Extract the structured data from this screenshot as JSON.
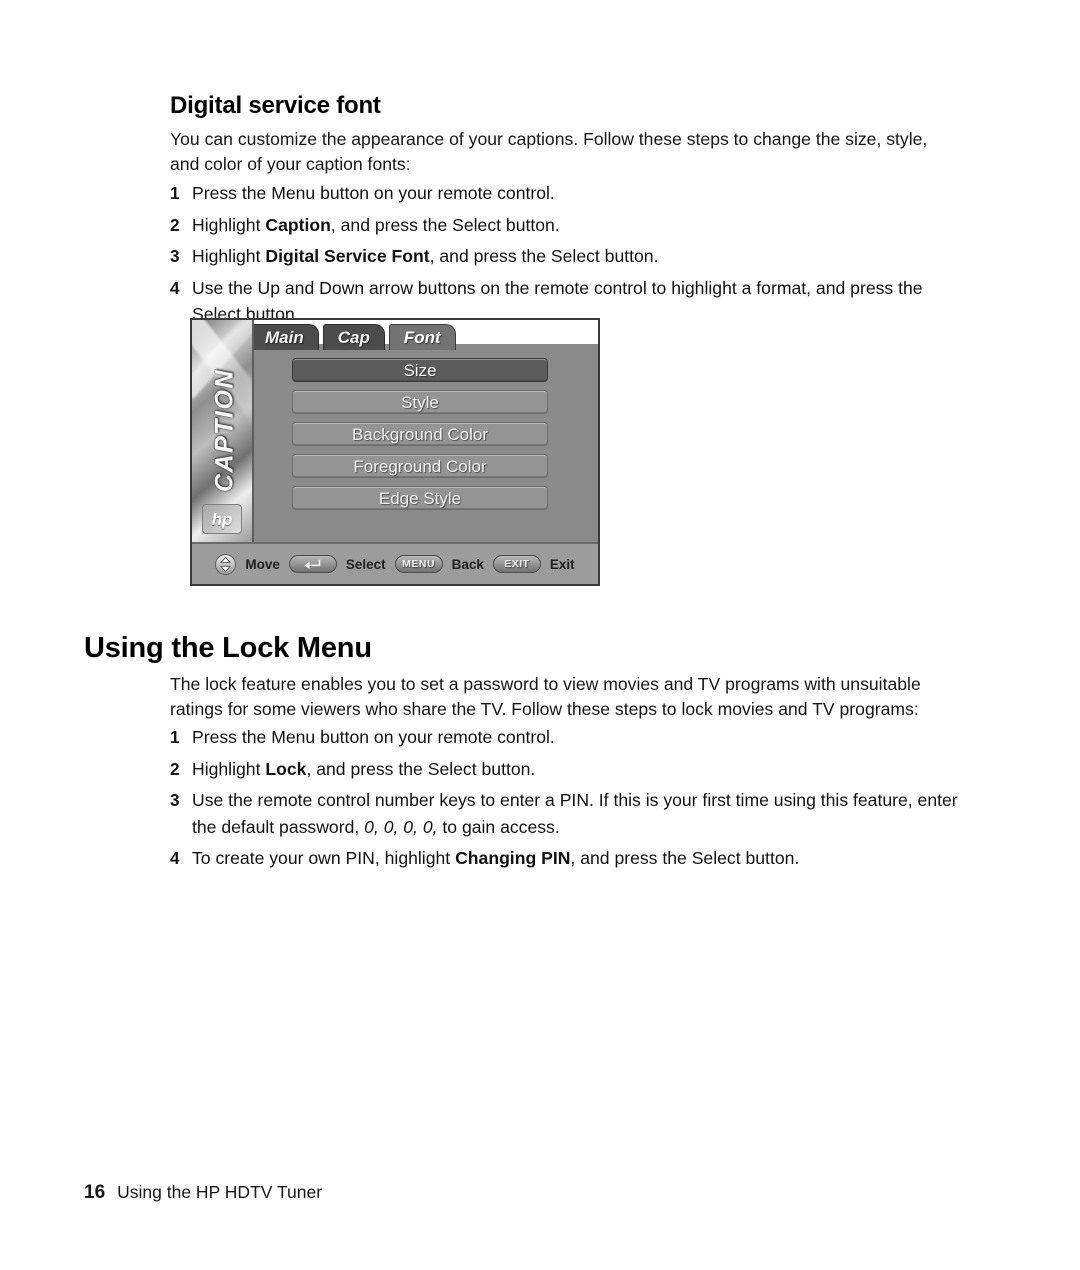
{
  "section1": {
    "heading": "Digital service font",
    "intro": "You can customize the appearance of your captions. Follow these steps to change the size, style, and color of your caption fonts:",
    "steps": [
      {
        "num": "1",
        "text": "Press the Menu button on your remote control."
      },
      {
        "num": "2",
        "pre": "Highlight ",
        "bold": "Caption",
        "post": ", and press the Select button."
      },
      {
        "num": "3",
        "pre": "Highlight ",
        "bold": "Digital Service Font",
        "post": ", and press the Select button."
      },
      {
        "num": "4",
        "text": "Use the Up and Down arrow buttons on the remote control to highlight a format, and press the Select button."
      }
    ]
  },
  "osd": {
    "sidebar_label": "CAPTION",
    "brand": "hp",
    "tabs": [
      {
        "label": "Main",
        "active": false
      },
      {
        "label": "Cap",
        "active": false
      },
      {
        "label": "Font",
        "active": true
      }
    ],
    "menu_items": [
      {
        "label": "Size",
        "selected": true
      },
      {
        "label": "Style",
        "selected": false
      },
      {
        "label": "Background Color",
        "selected": false
      },
      {
        "label": "Foreground Color",
        "selected": false
      },
      {
        "label": "Edge Style",
        "selected": false
      }
    ],
    "status_bar": {
      "move_label": "Move",
      "select_label": "Select",
      "menu_button": "MENU",
      "back_label": "Back",
      "exit_button": "EXIT",
      "exit_label": "Exit"
    },
    "colors": {
      "panel_bg": "#8a8a8a",
      "item_bg": "#949494",
      "item_selected_bg": "#5c5c5c",
      "tab_inactive_bg": "#4c4c4c",
      "tab_active_bg": "#737373",
      "status_bg": "#9c9c9c",
      "border": "#3b3b3b"
    }
  },
  "section2": {
    "heading": "Using the Lock Menu",
    "intro": "The lock feature enables you to set a password to view movies and TV programs with unsuitable ratings for some viewers who share the TV. Follow these steps to lock movies and TV programs:",
    "steps": [
      {
        "num": "1",
        "text": "Press the Menu button on your remote control."
      },
      {
        "num": "2",
        "pre": "Highlight ",
        "bold": "Lock",
        "post": ", and press the Select button."
      },
      {
        "num": "3",
        "pre": "Use the remote control number keys to enter a PIN. If this is your first time using this feature, enter the default password, ",
        "italic": "0, 0, 0, 0,",
        "post": " to gain access."
      },
      {
        "num": "4",
        "pre": "To create your own PIN, highlight ",
        "bold": "Changing PIN",
        "post": ", and press the Select button."
      }
    ]
  },
  "footer": {
    "page_number": "16",
    "text": "Using the HP HDTV Tuner"
  }
}
